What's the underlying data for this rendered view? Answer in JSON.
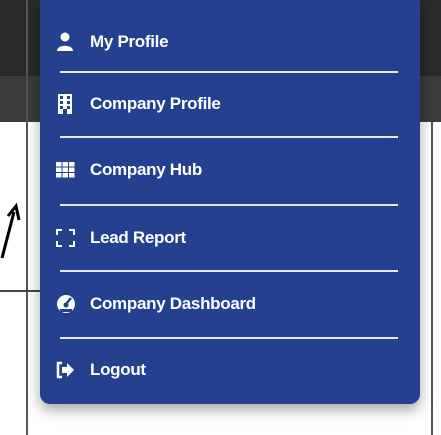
{
  "menu": {
    "items": [
      {
        "label": "My Profile",
        "icon": "user-icon"
      },
      {
        "label": "Company Profile",
        "icon": "building-icon"
      },
      {
        "label": "Company Hub",
        "icon": "grid-icon"
      },
      {
        "label": "Lead Report",
        "icon": "expand-icon"
      },
      {
        "label": "Company Dashboard",
        "icon": "dashboard-gauge-icon"
      },
      {
        "label": "Logout",
        "icon": "logout-icon"
      }
    ]
  },
  "colors": {
    "menu_background": "#25408f",
    "menu_text": "#ffffff",
    "divider": "#e6e9f3"
  }
}
